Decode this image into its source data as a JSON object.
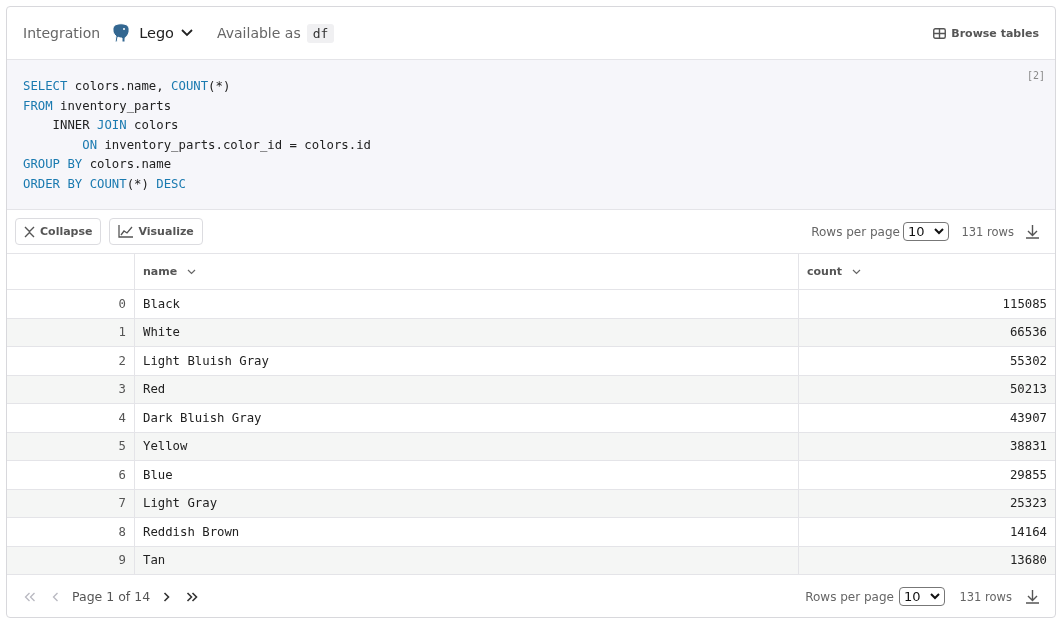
{
  "header": {
    "integration_label": "Integration",
    "integration_name": "Lego",
    "available_label": "Available as",
    "variable": "df",
    "browse_button": "Browse tables"
  },
  "code": {
    "cell_counter": "[2]",
    "lines": [
      [
        {
          "kind": "keyword",
          "text": "SELECT"
        },
        {
          "kind": "text",
          "text": " colors.name, "
        },
        {
          "kind": "keyword",
          "text": "COUNT"
        },
        {
          "kind": "text",
          "text": "(*)"
        }
      ],
      [
        {
          "kind": "keyword",
          "text": "FROM"
        },
        {
          "kind": "text",
          "text": " inventory_parts"
        }
      ],
      [
        {
          "kind": "text",
          "text": "    INNER "
        },
        {
          "kind": "keyword",
          "text": "JOIN"
        },
        {
          "kind": "text",
          "text": " colors"
        }
      ],
      [
        {
          "kind": "keyword",
          "text": "        ON"
        },
        {
          "kind": "text",
          "text": " inventory_parts.color_id = colors.id"
        }
      ],
      [
        {
          "kind": "keyword",
          "text": "GROUP BY"
        },
        {
          "kind": "text",
          "text": " colors.name"
        }
      ],
      [
        {
          "kind": "keyword",
          "text": "ORDER BY COUNT"
        },
        {
          "kind": "text",
          "text": "(*) "
        },
        {
          "kind": "keyword",
          "text": "DESC"
        }
      ]
    ]
  },
  "toolbar": {
    "collapse_button": "Collapse",
    "visualize_button": "Visualize",
    "rows_per_page_label": "Rows per page",
    "rows_per_page": "10",
    "row_count": "131 rows"
  },
  "table": {
    "columns": [
      "name",
      "count"
    ],
    "rows": [
      {
        "index": "0",
        "name": "Black",
        "count": "115085"
      },
      {
        "index": "1",
        "name": "White",
        "count": "66536"
      },
      {
        "index": "2",
        "name": "Light Bluish Gray",
        "count": "55302"
      },
      {
        "index": "3",
        "name": "Red",
        "count": "50213"
      },
      {
        "index": "4",
        "name": "Dark Bluish Gray",
        "count": "43907"
      },
      {
        "index": "5",
        "name": "Yellow",
        "count": "38831"
      },
      {
        "index": "6",
        "name": "Blue",
        "count": "29855"
      },
      {
        "index": "7",
        "name": "Light Gray",
        "count": "25323"
      },
      {
        "index": "8",
        "name": "Reddish Brown",
        "count": "14164"
      },
      {
        "index": "9",
        "name": "Tan",
        "count": "13680"
      }
    ]
  },
  "footer": {
    "page_label": "Page 1 of 14",
    "first_disabled": true,
    "previous_disabled": true,
    "next_disabled": false,
    "last_disabled": false,
    "rows_per_page_label": "Rows per page",
    "rows_per_page": "10",
    "row_count": "131 rows"
  }
}
